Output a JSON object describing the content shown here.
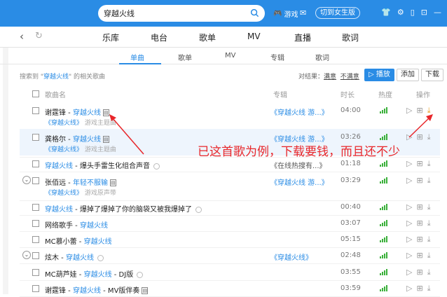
{
  "search": {
    "value": "穿越火线"
  },
  "topbar": {
    "games_label": "游戏",
    "switch_label": "切到女生版"
  },
  "nav": {
    "tabs": [
      "乐库",
      "电台",
      "歌单",
      "MV",
      "直播",
      "歌词"
    ]
  },
  "subtabs": [
    "单曲",
    "歌单",
    "MV",
    "专辑",
    "歌词"
  ],
  "info": {
    "prefix": "搜索到 \"",
    "keyword": "穿越火线",
    "suffix": "\" 的相关歌曲"
  },
  "filter": {
    "label": "对结果：",
    "opt1": "满意",
    "opt2": "不满意"
  },
  "buttons": {
    "play": "▷ 播放",
    "add": "添加",
    "download": "下载"
  },
  "columns": {
    "name": "歌曲名",
    "album": "专辑",
    "duration": "时长",
    "heat": "热度",
    "ops": "操作"
  },
  "songs": [
    {
      "artist": "谢霆锋",
      "title": "穿越火线",
      "sub_hl": "《穿越火线》",
      "sub": "游戏主题曲",
      "album": "《穿越火线 游...》",
      "duration": "04:00"
    },
    {
      "artist": "龚格尔",
      "title": "穿越火线",
      "sub_hl": "《穿越火线》",
      "sub": "游戏主题曲",
      "album": "《穿越火线 游...》",
      "duration": "03:26"
    },
    {
      "artist": "",
      "title": "穿越火线",
      "rest": " - 爆头手雷生化组合声音",
      "album": "《在线热搜有...》",
      "duration": "01:18"
    },
    {
      "artist": "张佰远",
      "title": "年轻不服输",
      "sub_hl": "《穿越火线》",
      "sub": "游戏原声带",
      "album": "《穿越火线 游...》",
      "duration": "03:29"
    },
    {
      "artist": "",
      "title": "穿越火线",
      "rest": " - 爆掉了爆掉了你的脑袋又被我爆掉了",
      "album": "",
      "duration": "00:40"
    },
    {
      "artist": "网络歌手",
      "title": "穿越火线",
      "album": "",
      "duration": "03:07"
    },
    {
      "artist": "MC慕小蕾",
      "title": "穿越火线",
      "album": "",
      "duration": "05:15"
    },
    {
      "artist": "炫木",
      "title": "穿越火线",
      "album": "《穿越火线》",
      "duration": "02:48"
    },
    {
      "artist": "MC葫芦娃",
      "title": "穿越火线",
      "rest": " - DJ版",
      "album": "",
      "duration": "03:55"
    },
    {
      "artist": "谢霆锋",
      "title": "穿越火线",
      "rest": " - MV版伴奏",
      "album": "",
      "duration": "03:59"
    }
  ],
  "annotation": "已这首歌为例，下载要钱，而且还不少",
  "colors": {
    "brand": "#2a8ce5",
    "annotation": "#e8262a"
  }
}
